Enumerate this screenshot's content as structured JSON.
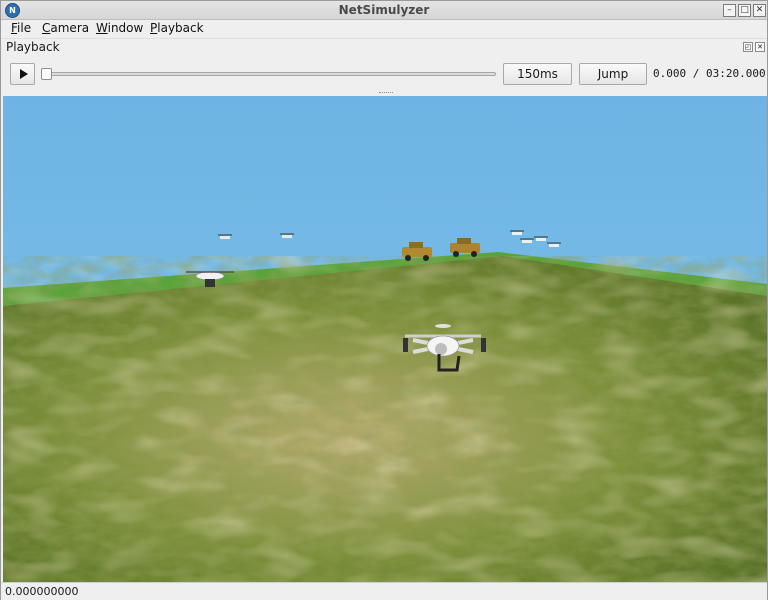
{
  "window": {
    "title": "NetSimulyzer",
    "app_icon_glyph": "N",
    "controls": {
      "minimize": "–",
      "maximize": "□",
      "close": "✕"
    }
  },
  "menu": {
    "file": {
      "mnemonic": "F",
      "rest": "ile"
    },
    "camera": {
      "mnemonic": "C",
      "rest": "amera"
    },
    "window": {
      "mnemonic": "W",
      "rest": "indow"
    },
    "playback": {
      "mnemonic": "P",
      "rest": "layback"
    }
  },
  "playback": {
    "dock_title": "Playback",
    "float_glyph": "◰",
    "close_glyph": "✕",
    "step_label": "150ms",
    "jump_label": "Jump",
    "time_readout": "0.000 / 03:20.000",
    "progress": 0.0
  },
  "status": {
    "text": "0.000000000"
  },
  "scene": {
    "colors": {
      "sky_top": "#6db4e4",
      "sky_bottom": "#82c4ea",
      "ground_far": "#5aa33a",
      "terrain_dark": "#4f6a22",
      "terrain_mid": "#7c8f3a",
      "terrain_light": "#b9ad72"
    },
    "objects": [
      "drone-near",
      "drone-left",
      "drone-small-1",
      "drone-small-2",
      "vehicle-1",
      "vehicle-2",
      "drone-cluster"
    ]
  }
}
